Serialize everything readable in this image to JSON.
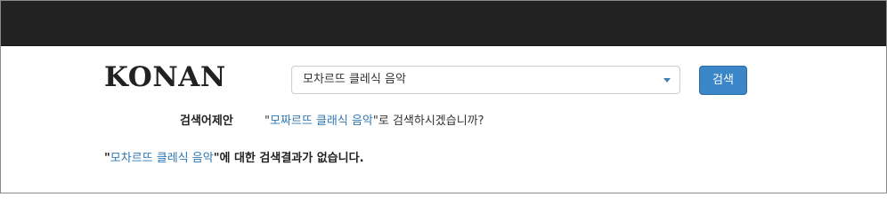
{
  "header": {
    "logo": "KONAN"
  },
  "search": {
    "value": "모차르뜨 클레식 음악",
    "button_label": "검색"
  },
  "suggestion": {
    "label": "검색어제안",
    "open_quote": "\"",
    "keyword": "모짜르뜨 클래식 음악",
    "close_quote": "\"",
    "suffix": "로 검색하시겠습니까?"
  },
  "result_message": {
    "open_quote": "\"",
    "keyword": "모차르뜨 클레식 음악",
    "close_quote": "\"",
    "suffix": "에 대한 검색결과가 없습니다."
  },
  "colors": {
    "topbar": "#222222",
    "accent": "#3a86c8",
    "link": "#2f78b5",
    "border": "#8a8a8a"
  },
  "icons": {
    "dropdown": "chevron-down-icon"
  }
}
